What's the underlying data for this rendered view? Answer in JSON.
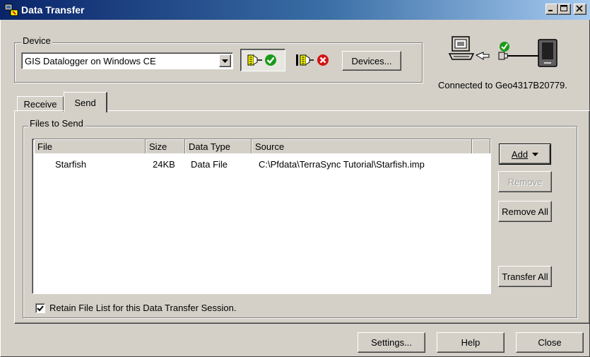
{
  "window": {
    "title": "Data Transfer",
    "title_color": "#0a246a"
  },
  "device": {
    "group_label": "Device",
    "selected": "GIS Datalogger on Windows CE",
    "devices_button": "Devices...",
    "connect_icon": "connect-plug-check-icon",
    "disconnect_icon": "disconnect-plug-x-icon",
    "status": "Connected to Geo4317B20779."
  },
  "tabs": [
    {
      "label": "Receive",
      "active": false
    },
    {
      "label": "Send",
      "active": true
    }
  ],
  "files": {
    "group_label": "Files to Send",
    "columns": [
      "File",
      "Size",
      "Data Type",
      "Source"
    ],
    "rows": [
      {
        "file": "Starfish",
        "size": "24KB",
        "type": "Data File",
        "source": "C:\\Pfdata\\TerraSync Tutorial\\Starfish.imp"
      }
    ],
    "retain_label": "Retain File List for this Data Transfer Session.",
    "retain_checked": true
  },
  "side_buttons": {
    "add": "Add",
    "remove": "Remove",
    "remove_all": "Remove All",
    "transfer_all": "Transfer All"
  },
  "footer": {
    "settings": "Settings...",
    "help": "Help",
    "close": "Close"
  },
  "colors": {
    "success_green": "#1a9a1a",
    "error_red": "#d21414"
  }
}
